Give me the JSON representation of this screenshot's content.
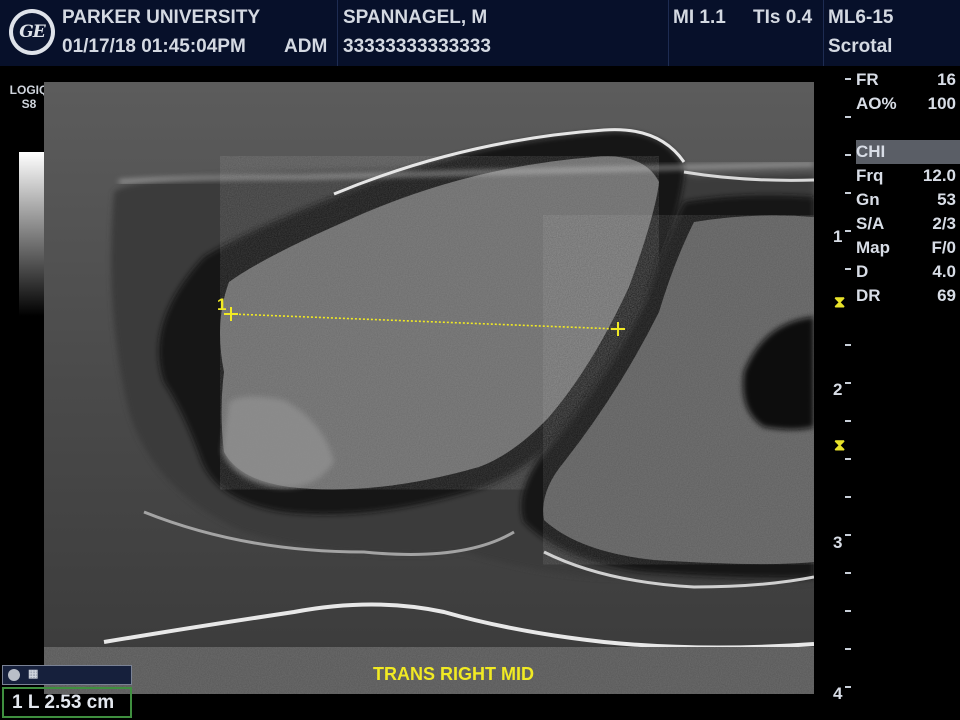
{
  "header": {
    "institution": "PARKER UNIVERSITY",
    "datetime": "01/17/18 01:45:04PM",
    "operator": "ADM",
    "patient_name": "SPANNAGEL, M",
    "patient_id": "33333333333333",
    "mi": "MI 1.1",
    "tis": "TIs 0.4",
    "probe": "ML6-15",
    "preset": "Scrotal",
    "logo_text": "GE"
  },
  "device": {
    "line1": "LOGIQ",
    "line2": "S8"
  },
  "params": [
    {
      "key": "FR",
      "value": "16"
    },
    {
      "key": "AO%",
      "value": "100"
    },
    {
      "key": "",
      "value": ""
    },
    {
      "key": "CHI",
      "value": "",
      "highlight": true
    },
    {
      "key": "Frq",
      "value": "12.0"
    },
    {
      "key": "Gn",
      "value": "53"
    },
    {
      "key": "S/A",
      "value": "2/3"
    },
    {
      "key": "Map",
      "value": "F/0"
    },
    {
      "key": "D",
      "value": "4.0"
    },
    {
      "key": "DR",
      "value": "69"
    }
  ],
  "depth_scale": {
    "labels": [
      "1",
      "2",
      "3",
      "4"
    ],
    "max_cm": 4.0
  },
  "caliper": {
    "index": "1"
  },
  "annotation": "TRANS RIGHT MID",
  "measurement": {
    "index": "1",
    "type": "L",
    "value": "2.53 cm"
  },
  "colors": {
    "header_bg": "#07102a",
    "annotation": "#f1ea23",
    "measurement_border": "#3f8f3f",
    "focal_marker": "#e8e22a"
  },
  "icons": [
    "ge-logo",
    "toggle-circle-icon",
    "probe-icon",
    "focal-zone-marker"
  ]
}
